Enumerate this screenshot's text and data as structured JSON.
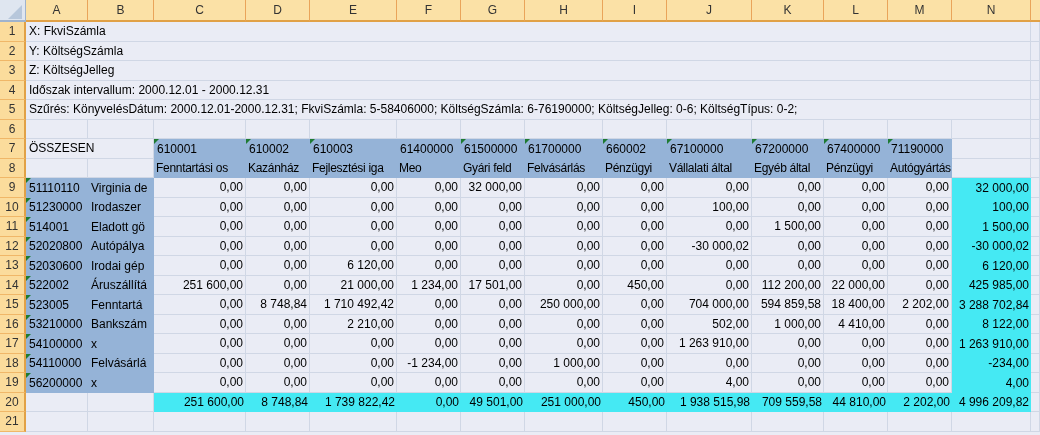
{
  "column_headers": [
    "A",
    "B",
    "C",
    "D",
    "E",
    "F",
    "G",
    "H",
    "I",
    "J",
    "K",
    "L",
    "M",
    "N"
  ],
  "row_numbers": [
    "1",
    "2",
    "3",
    "4",
    "5",
    "6",
    "7",
    "8",
    "9",
    "10",
    "11",
    "12",
    "13",
    "14",
    "15",
    "16",
    "17",
    "18",
    "19",
    "20",
    "21"
  ],
  "info_lines": [
    "X: FkviSzámla",
    "Y: KöltségSzámla",
    "Z: KöltségJelleg",
    "Időszak intervallum: 2000.12.01 - 2000.12.31",
    "Szűrés:  KönyvelésDátum: 2000.12.01-2000.12.31;  FkviSzámla: 5-58406000;  KöltségSzámla: 6-76190000;  KöltségJelleg: 0-6;  KöltségTípus: 0-2;"
  ],
  "summary_label": "ÖSSZESEN",
  "columns": [
    {
      "code": "610001",
      "name": "Fenntartási os",
      "flagged": true
    },
    {
      "code": "610002",
      "name": "Kazánház",
      "flagged": true
    },
    {
      "code": "610003",
      "name": "Fejlesztési iga",
      "flagged": true
    },
    {
      "code": "61400000",
      "name": "Meo",
      "flagged": false
    },
    {
      "code": "61500000",
      "name": "Gyári feld",
      "flagged": true
    },
    {
      "code": "61700000",
      "name": "Felvásárlás",
      "flagged": true
    },
    {
      "code": "660002",
      "name": "Pénzügyi",
      "flagged": true
    },
    {
      "code": "67100000",
      "name": "Vállalati által",
      "flagged": true
    },
    {
      "code": "67200000",
      "name": "Egyéb által",
      "flagged": true
    },
    {
      "code": "67400000",
      "name": "Pénzügyi",
      "flagged": true
    },
    {
      "code": "71190000",
      "name": "Autógyártás",
      "flagged": true
    }
  ],
  "rows": [
    {
      "code": "51110110",
      "name": "Virginia de",
      "flagged": true,
      "values": [
        "0,00",
        "0,00",
        "0,00",
        "0,00",
        "32 000,00",
        "0,00",
        "0,00",
        "0,00",
        "0,00",
        "0,00",
        "0,00"
      ],
      "total": "32 000,00"
    },
    {
      "code": "51230000",
      "name": "Irodaszer",
      "flagged": true,
      "values": [
        "0,00",
        "0,00",
        "0,00",
        "0,00",
        "0,00",
        "0,00",
        "0,00",
        "100,00",
        "0,00",
        "0,00",
        "0,00"
      ],
      "total": "100,00"
    },
    {
      "code": "514001",
      "name": "Eladott gö",
      "flagged": true,
      "values": [
        "0,00",
        "0,00",
        "0,00",
        "0,00",
        "0,00",
        "0,00",
        "0,00",
        "0,00",
        "1 500,00",
        "0,00",
        "0,00"
      ],
      "total": "1 500,00"
    },
    {
      "code": "52020800",
      "name": "Autópálya",
      "flagged": true,
      "values": [
        "0,00",
        "0,00",
        "0,00",
        "0,00",
        "0,00",
        "0,00",
        "0,00",
        "-30 000,02",
        "0,00",
        "0,00",
        "0,00"
      ],
      "total": "-30 000,02"
    },
    {
      "code": "52030600",
      "name": "Irodai gép",
      "flagged": true,
      "values": [
        "0,00",
        "0,00",
        "6 120,00",
        "0,00",
        "0,00",
        "0,00",
        "0,00",
        "0,00",
        "0,00",
        "0,00",
        "0,00"
      ],
      "total": "6 120,00"
    },
    {
      "code": "522002",
      "name": "Áruszállítá",
      "flagged": true,
      "values": [
        "251 600,00",
        "0,00",
        "21 000,00",
        "1 234,00",
        "17 501,00",
        "0,00",
        "450,00",
        "0,00",
        "112 200,00",
        "22 000,00",
        "0,00"
      ],
      "total": "425 985,00"
    },
    {
      "code": "523005",
      "name": "Fenntartá",
      "flagged": true,
      "values": [
        "0,00",
        "8 748,84",
        "1 710 492,42",
        "0,00",
        "0,00",
        "250 000,00",
        "0,00",
        "704 000,00",
        "594 859,58",
        "18 400,00",
        "2 202,00"
      ],
      "total": "3 288 702,84"
    },
    {
      "code": "53210000",
      "name": "Bankszám",
      "flagged": true,
      "values": [
        "0,00",
        "0,00",
        "2 210,00",
        "0,00",
        "0,00",
        "0,00",
        "0,00",
        "502,00",
        "1 000,00",
        "4 410,00",
        "0,00"
      ],
      "total": "8 122,00"
    },
    {
      "code": "54100000",
      "name": "x",
      "flagged": true,
      "values": [
        "0,00",
        "0,00",
        "0,00",
        "0,00",
        "0,00",
        "0,00",
        "0,00",
        "1 263 910,00",
        "0,00",
        "0,00",
        "0,00"
      ],
      "total": "1 263 910,00"
    },
    {
      "code": "54110000",
      "name": "Felvásárlá",
      "flagged": true,
      "values": [
        "0,00",
        "0,00",
        "0,00",
        "-1 234,00",
        "0,00",
        "1 000,00",
        "0,00",
        "0,00",
        "0,00",
        "0,00",
        "0,00"
      ],
      "total": "-234,00"
    },
    {
      "code": "56200000",
      "name": "x",
      "flagged": true,
      "values": [
        "0,00",
        "0,00",
        "0,00",
        "0,00",
        "0,00",
        "0,00",
        "0,00",
        "4,00",
        "0,00",
        "0,00",
        "0,00"
      ],
      "total": "4,00"
    }
  ],
  "totals": {
    "values": [
      "251 600,00",
      "8 748,84",
      "1 739 822,42",
      "0,00",
      "49 501,00",
      "251 000,00",
      "450,00",
      "1 938 515,98",
      "709 559,58",
      "44 810,00",
      "2 202,00"
    ],
    "grand_total": "4 996 209,82"
  }
}
